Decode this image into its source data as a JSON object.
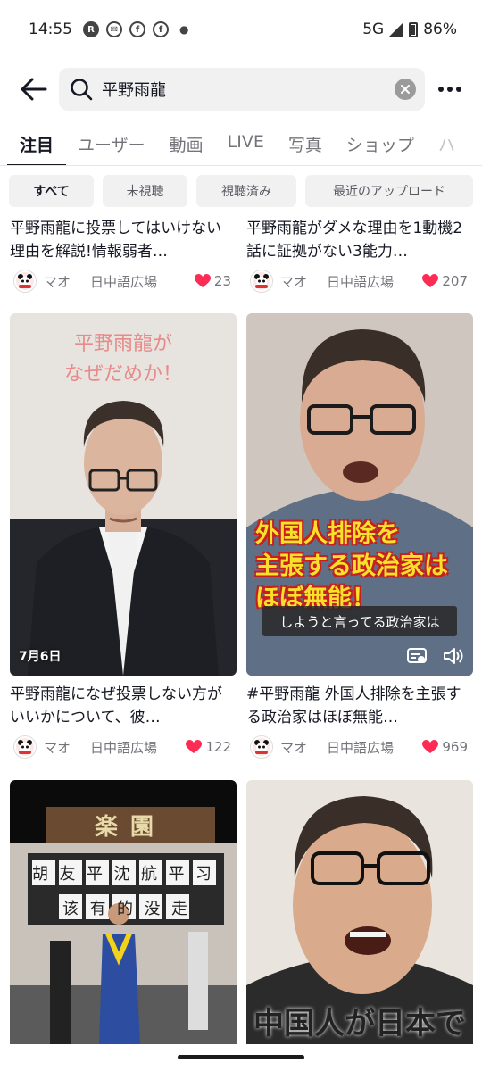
{
  "status_bar": {
    "time": "14:55",
    "network": "5G",
    "battery": "86%"
  },
  "search": {
    "query": "平野雨龍"
  },
  "tabs": [
    {
      "label": "注目",
      "active": true
    },
    {
      "label": "ユーザー"
    },
    {
      "label": "動画"
    },
    {
      "label": "LIVE"
    },
    {
      "label": "写真"
    },
    {
      "label": "ショップ"
    },
    {
      "label": "ハ"
    }
  ],
  "filters": [
    "すべて",
    "未視聴",
    "視聴済み",
    "最近のアップロード"
  ],
  "results": [
    {
      "caption": "平野雨龍に投票してはいけない理由を解説!情報弱者…",
      "author": "マオ",
      "channel": "日中語広場",
      "likes": "23"
    },
    {
      "caption": "平野雨龍がダメな理由を1動機2話に証拠がない3能力…",
      "author": "マオ",
      "channel": "日中語広場",
      "likes": "207"
    },
    {
      "caption": "平野雨龍になぜ投票しない方がいいかについて、彼…",
      "author": "マオ",
      "channel": "日中語広場",
      "likes": "122",
      "thumb_text": "平野雨龍が\nなぜだめか！",
      "date": "7月6日"
    },
    {
      "caption": "#平野雨龍 外国人排除を主張する政治家はほぼ無能…",
      "author": "マオ",
      "channel": "日中語広場",
      "likes": "969",
      "thumb_text": "外国人排除を\n主張する政治家は\nほぼ無能！",
      "subtitle": "しようと言ってる政治家は"
    },
    {
      "sign_top": "楽園",
      "sign_row1": "胡友平沈航平习近平",
      "sign_row2": "该有的没走"
    },
    {
      "thumb_text": "中国人が日本で"
    }
  ]
}
